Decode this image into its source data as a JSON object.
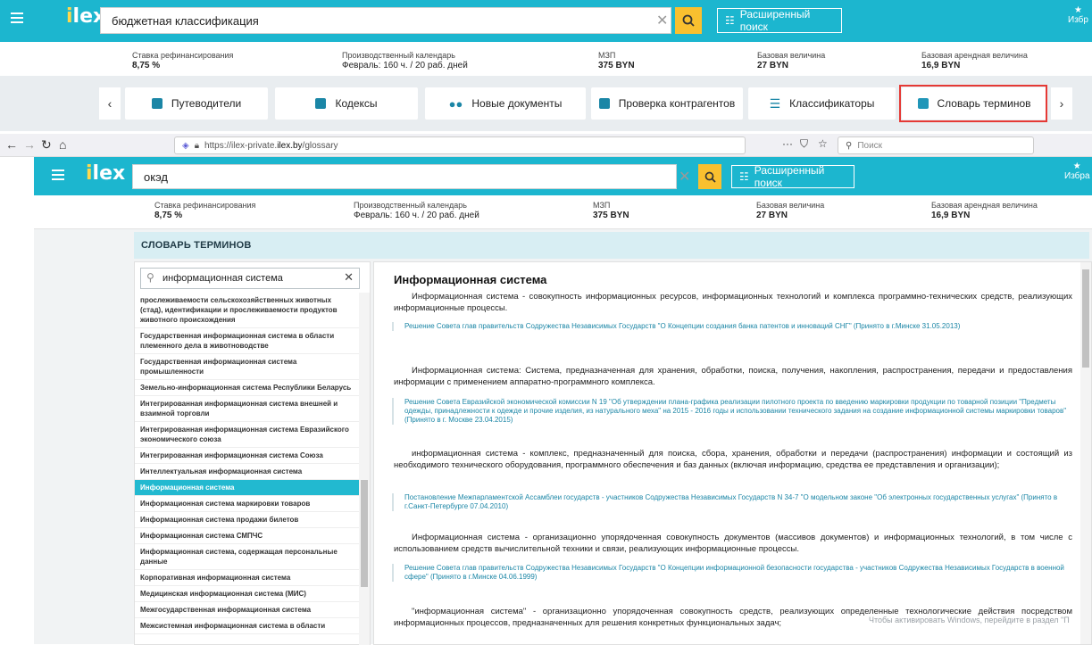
{
  "bg": {
    "search": {
      "value": "бюджетная классификация",
      "advanced": "Расширенный поиск",
      "fav": "Избр"
    },
    "info": [
      {
        "label": "Ставка рефинансирования",
        "value": "8,75 %"
      },
      {
        "label": "Производственный календарь",
        "value": "Февраль: 160 ч. / 20 раб. дней"
      },
      {
        "label": "МЗП",
        "value": "375 BYN"
      },
      {
        "label": "Базовая величина",
        "value": "27 BYN"
      },
      {
        "label": "Базовая арендная величина",
        "value": "16,9 BYN"
      }
    ],
    "quick": [
      "Путеводители",
      "Кодексы",
      "Новые документы",
      "Проверка контрагентов",
      "Классификаторы",
      "Словарь терминов"
    ]
  },
  "browser": {
    "url_prefix": "https://ilex-private.",
    "url_domain": "ilex.by",
    "url_path": "/glossary",
    "search_placeholder": "Поиск",
    "menu": "···"
  },
  "fg": {
    "search": {
      "value": "окэд",
      "advanced": "Расширенный поиск",
      "fav": "Избра"
    },
    "info": [
      {
        "label": "Ставка рефинансирования",
        "value": "8,75 %"
      },
      {
        "label": "Производственный календарь",
        "value": "Февраль: 160 ч. / 20 раб. дней"
      },
      {
        "label": "МЗП",
        "value": "375 BYN"
      },
      {
        "label": "Базовая величина",
        "value": "27 BYN"
      },
      {
        "label": "Базовая арендная величина",
        "value": "16,9 BYN"
      }
    ],
    "glossary_header": "СЛОВАРЬ ТЕРМИНОВ",
    "term_search": "информационная система",
    "terms": [
      "прослеживаемости сельскохозяйственных животных (стад), идентификации и прослеживаемости продуктов животного происхождения",
      "Государственная информационная система в области племенного дела в животноводстве",
      "Государственная информационная система промышленности",
      "Земельно-информационная система Республики Беларусь",
      "Интегрированная информационная система внешней и взаимной торговли",
      "Интегрированная информационная система Евразийского экономического союза",
      "Интегрированная информационная система Союза",
      "Интеллектуальная информационная система",
      "Информационная система",
      "Информационная система маркировки товаров",
      "Информационная система продажи билетов",
      "Информационная система СМПЧС",
      "Информационная система, содержащая персональные данные",
      "Корпоративная информационная система",
      "Медицинская информационная система (МИС)",
      "Межгосударственная информационная система",
      "Межсистемная информационная система в области"
    ],
    "active_term_index": 8,
    "article_title": "Информационная система",
    "definitions": [
      {
        "text": "Информационная система - совокупность информационных ресурсов, информационных технологий и комплекса программно-технических средств, реализующих информационные процессы.",
        "source": "Решение Совета глав правительств Содружества Независимых Государств \"О Концепции создания банка патентов и инноваций СНГ\" (Принято в г.Минске 31.05.2013)"
      },
      {
        "text": "Информационная система: Система, предназначенная для хранения, обработки, поиска, получения, накопления, распространения, передачи и предоставления информации с применением аппаратно-программного комплекса.",
        "source": "Решение Совета Евразийской экономической комиссии N 19 \"Об утверждении плана-графика реализации пилотного проекта по введению маркировки продукции по товарной позиции \"Предметы одежды, принадлежности к одежде и прочие изделия, из натурального меха\" на 2015 - 2016 годы и использовании технического задания на создание информационной системы маркировки товаров\" (Принято в г. Москве 23.04.2015)"
      },
      {
        "text": "информационная система - комплекс, предназначенный для поиска, сбора, хранения, обработки и передачи (распространения) информации и состоящий из необходимого технического оборудования, программного обеспечения и баз данных (включая информацию, средства ее представления и организации);",
        "source": "Постановление Межпарламентской Ассамблеи государств - участников Содружества Независимых Государств N 34-7 \"О модельном законе \"Об электронных государственных услугах\" (Принято в г.Санкт-Петербурге 07.04.2010)"
      },
      {
        "text": "Информационная система - организационно упорядоченная совокупность документов (массивов документов) и информационных технологий, в том числе с использованием средств вычислительной техники и связи, реализующих информационные процессы.",
        "source": "Решение Совета глав правительств Содружества Независимых Государств \"О Концепции информационной безопасности государства - участников Содружества Независимых Государств в военной сфере\" (Принято в г.Минске 04.06.1999)"
      },
      {
        "text": "\"информационная система\" - организационно упорядоченная совокупность средств, реализующих определенные технологические действия посредством информационных процессов, предназначенных для решения конкретных функциональных задач;",
        "source": ""
      }
    ],
    "activation": "Чтобы активировать Windows, перейдите в раздел \"П"
  },
  "colors": {
    "brand": "#1cb6cf",
    "accent": "#f9c02f",
    "link": "#1b86a6",
    "highlight": "#e53935"
  }
}
